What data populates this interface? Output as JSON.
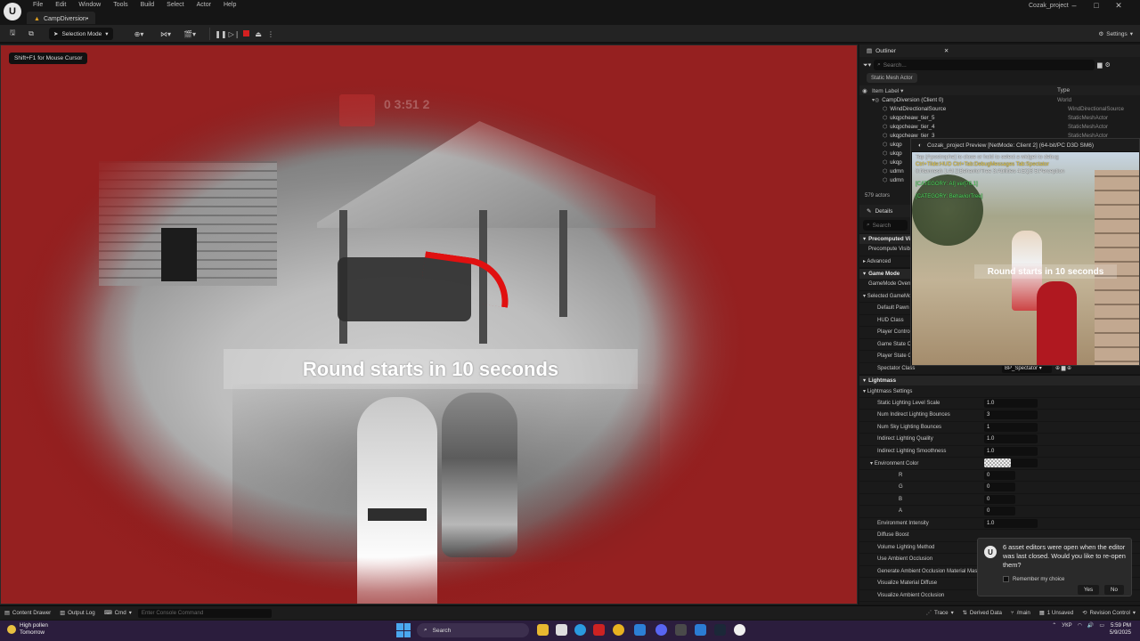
{
  "app": {
    "project_tab": "CampDiversion•",
    "window_title": "Cozak_project",
    "menu": [
      "File",
      "Edit",
      "Window",
      "Tools",
      "Build",
      "Select",
      "Actor",
      "Help"
    ]
  },
  "toolbar": {
    "selection_mode": "Selection Mode",
    "settings": "Settings"
  },
  "viewport": {
    "hint": "Shift+F1 for Mouse Cursor",
    "round_text": "Round starts in 10 seconds",
    "score_ghost": "0   3:51   2"
  },
  "outliner": {
    "tab": "Outliner",
    "search_placeholder": "Search...",
    "filter_chip": "Static Mesh Actor",
    "col_label": "Item Label",
    "col_type": "Type",
    "rows": [
      {
        "label": "CampDiversion (Client 0)",
        "type": "World"
      },
      {
        "label": "WindDirectionalSource",
        "type": "WindDirectionalSource"
      },
      {
        "label": "ukqpcheaw_tier_5",
        "type": "StaticMeshActor"
      },
      {
        "label": "ukqpcheaw_tier_4",
        "type": "StaticMeshActor"
      },
      {
        "label": "ukqpcheaw_tier_3",
        "type": "StaticMeshActor"
      },
      {
        "label": "ukqp",
        "type": ""
      },
      {
        "label": "ukqp",
        "type": ""
      },
      {
        "label": "ukqp",
        "type": ""
      },
      {
        "label": "udmn",
        "type": ""
      },
      {
        "label": "udmn",
        "type": ""
      }
    ],
    "actor_count": "579 actors"
  },
  "details": {
    "tab": "Details",
    "search_placeholder": "Search",
    "sections": {
      "precomputed": "Precomputed Visi",
      "precompute_label": "Precompute Visib",
      "advanced": "Advanced",
      "game_mode": "Game Mode",
      "gamemode_override": "GameMode Overr",
      "selected_gamemode": "Selected GameMo",
      "lightmass": "Lightmass",
      "lightmass_settings": "Lightmass Settings"
    },
    "gm_props": [
      "Default Pawn C",
      "HUD Class",
      "Player Controll",
      "Game State C",
      "Player State C"
    ],
    "spectator_label": "Spectator Class",
    "spectator_value": "BP_Spectator",
    "lm_props": [
      {
        "label": "Static Lighting Level Scale",
        "value": "1.0"
      },
      {
        "label": "Num Indirect Lighting Bounces",
        "value": "3"
      },
      {
        "label": "Num Sky Lighting Bounces",
        "value": "1"
      },
      {
        "label": "Indirect Lighting Quality",
        "value": "1.0"
      },
      {
        "label": "Indirect Lighting Smoothness",
        "value": "1.0"
      }
    ],
    "env_color_label": "Environment Color",
    "rgba": [
      {
        "label": "R",
        "value": "0"
      },
      {
        "label": "G",
        "value": "0"
      },
      {
        "label": "B",
        "value": "0"
      },
      {
        "label": "A",
        "value": "0"
      }
    ],
    "env_intensity": {
      "label": "Environment Intensity",
      "value": "1.0"
    },
    "tail_props": [
      "Diffuse Boost",
      "Volume Lighting Method",
      "Use Ambient Occlusion",
      "Generate Ambient Occlusion Material Mask",
      "Visualize Material Diffuse",
      "Visualize Ambient Occlusion"
    ]
  },
  "pie": {
    "title": "Cozak_project Preview [NetMode: Client 2]  (64-bit/PC D3D SM6)",
    "log_lines": [
      "Tap [Apostrophe] to close or hold to select a widget to debug",
      "Ctrl+Tilde:HUD  Ctrl+Tab:DebugMessages  Tab:Spectator",
      "0:Navmesh  1:AI  2:BehaviorTree  3:Abilities  4:EQS  5:Perception",
      "[CATEGORY: AI]  ver[76.1]",
      "[CATEGORY: BehaviorTree]"
    ],
    "round_text": "Round starts in 10 seconds"
  },
  "notification": {
    "text": "6 asset editors were open when the editor was last closed. Would you like to re-open them?",
    "remember": "Remember my choice",
    "yes": "Yes",
    "no": "No"
  },
  "statusbar": {
    "content_drawer": "Content Drawer",
    "output_log": "Output Log",
    "cmd": "Cmd",
    "console_placeholder": "Enter Console Command",
    "trace": "Trace",
    "derived_data": "Derived Data",
    "branch": "/main",
    "unsaved": "1 Unsaved",
    "revision_control": "Revision Control"
  },
  "taskbar": {
    "weather_title": "High pollen",
    "weather_sub": "Tomorrow",
    "search": "Search",
    "lang": "УКР",
    "time": "5:59 PM",
    "date": "5/9/2025"
  },
  "colors": {
    "editor_bg": "#151515",
    "accent_red": "#e01010",
    "vignette": "#962020",
    "taskbar": "#2b1d3d"
  }
}
